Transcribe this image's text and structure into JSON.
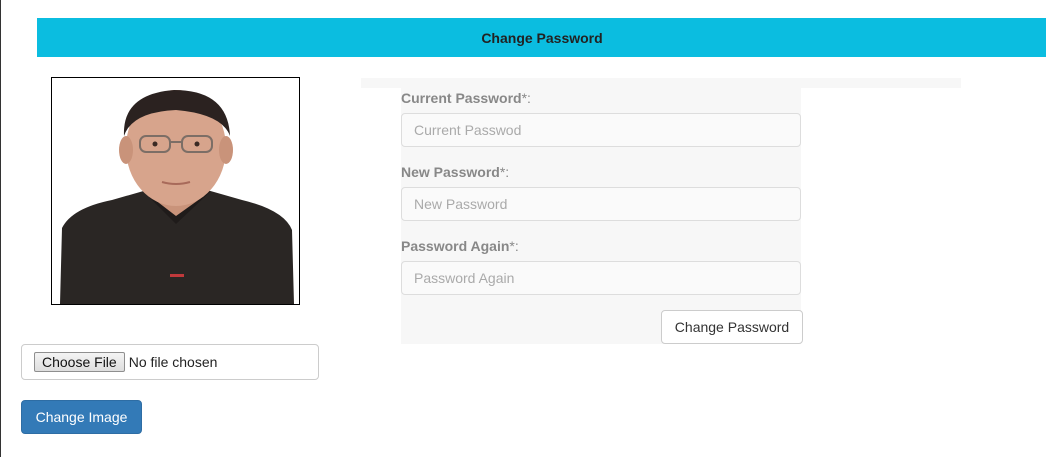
{
  "header": {
    "title": "Change Password"
  },
  "profile": {
    "photo_alt": "profile-photo",
    "file_input": {
      "button_label": "Choose File",
      "status_text": "No file chosen"
    },
    "change_image_label": "Change Image"
  },
  "form": {
    "current_password": {
      "label": "Current Password",
      "required_mark": "*:",
      "placeholder": "Current Passwod"
    },
    "new_password": {
      "label": "New Password",
      "required_mark": "*:",
      "placeholder": "New Password"
    },
    "password_again": {
      "label": "Password Again",
      "required_mark": "*:",
      "placeholder": "Password Again"
    },
    "submit_label": "Change Password"
  },
  "colors": {
    "header_bg": "#0bbde0",
    "primary_button": "#337ab7",
    "form_panel_bg": "#f7f7f7"
  }
}
